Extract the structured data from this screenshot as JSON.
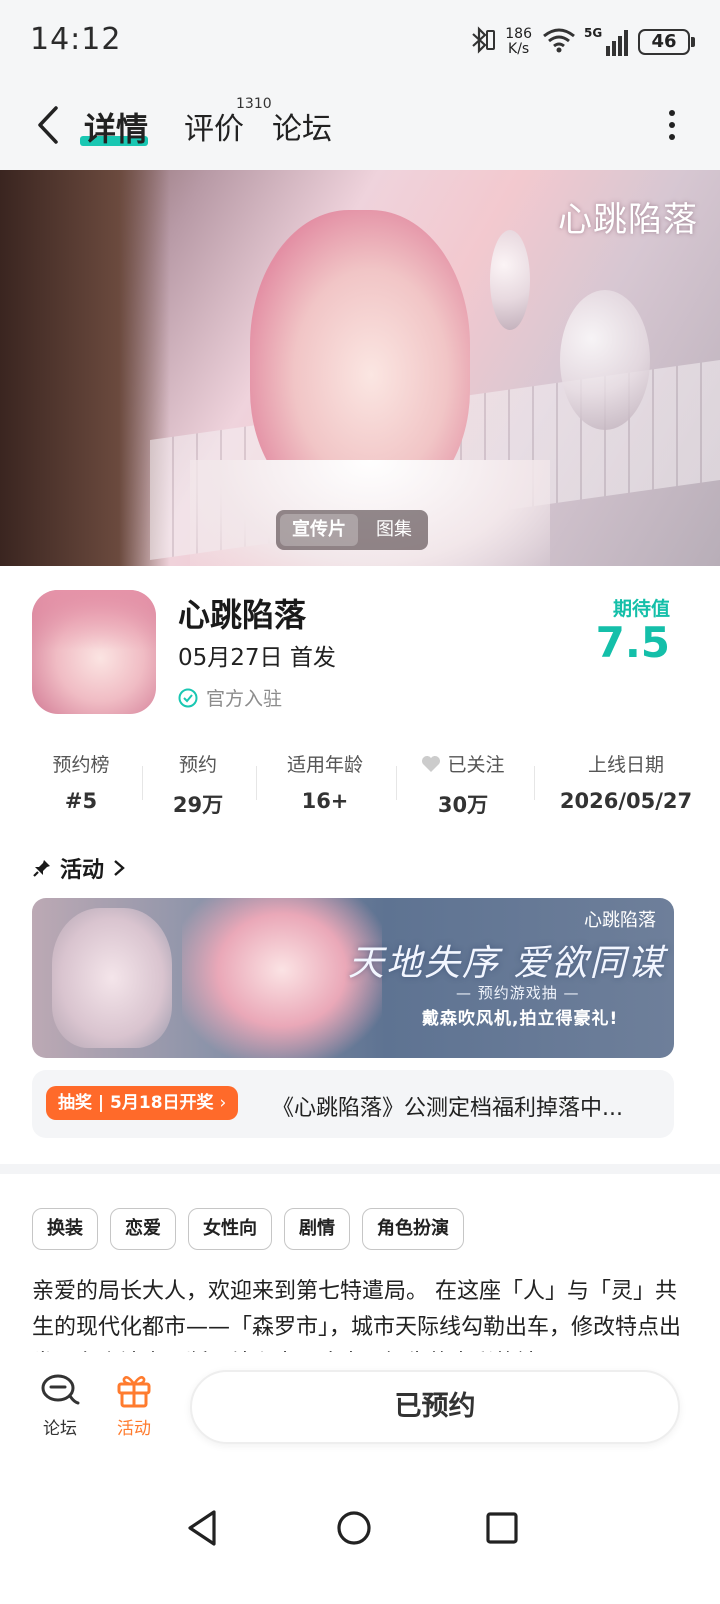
{
  "status_bar": {
    "time": "14:12",
    "net_speed_value": "186",
    "net_speed_unit": "K/s",
    "network": "5G",
    "battery": "46"
  },
  "nav": {
    "tab_details": "详情",
    "tab_reviews": "评价",
    "reviews_count": "1310",
    "tab_forum": "论坛"
  },
  "hero": {
    "logo_text": "心跳陷落",
    "media_tabs": [
      "宣传片",
      "图集"
    ]
  },
  "game": {
    "name": "心跳陷落",
    "release": "05月27日 首发",
    "official": "官方入驻",
    "expect_label": "期待值",
    "expect_value": "7.5"
  },
  "stats": [
    {
      "label": "预约榜",
      "value": "#5"
    },
    {
      "label": "预约",
      "value": "29万"
    },
    {
      "label": "适用年龄",
      "value": "16+"
    },
    {
      "label": "已关注",
      "value": "30万"
    },
    {
      "label": "上线日期",
      "value": "2026/05/27"
    }
  ],
  "activity": {
    "heading": "活动",
    "banner_logo": "心跳陷落",
    "banner_title": "天地失序 爱欲同谋",
    "banner_subtitle": "— 预约游戏抽 —",
    "banner_tagline": "戴森吹风机,拍立得豪礼!",
    "promo_badge": "抽奖 | 5月18日开奖",
    "promo_text": "《心跳陷落》公测定档福利掉落中..."
  },
  "tags": [
    "换装",
    "恋爱",
    "女性向",
    "剧情",
    "角色扮演"
  ],
  "description": "亲爱的局长大人，欢迎来到第七特遣局。 在这座「人」与「灵」共生的现代化都市——「森罗市」，城市天际线勾勒出车，修改特点出发，有小法出不断，结么大是这中只好生的光彩的社",
  "bottom_bar": {
    "forum": "论坛",
    "activity": "活动",
    "reserved": "已预约"
  },
  "colors": {
    "accent": "#19c7b2",
    "expect": "#14bfa9",
    "promo_orange": "#ff6a2a",
    "activity_orange": "#ff7b2e"
  }
}
